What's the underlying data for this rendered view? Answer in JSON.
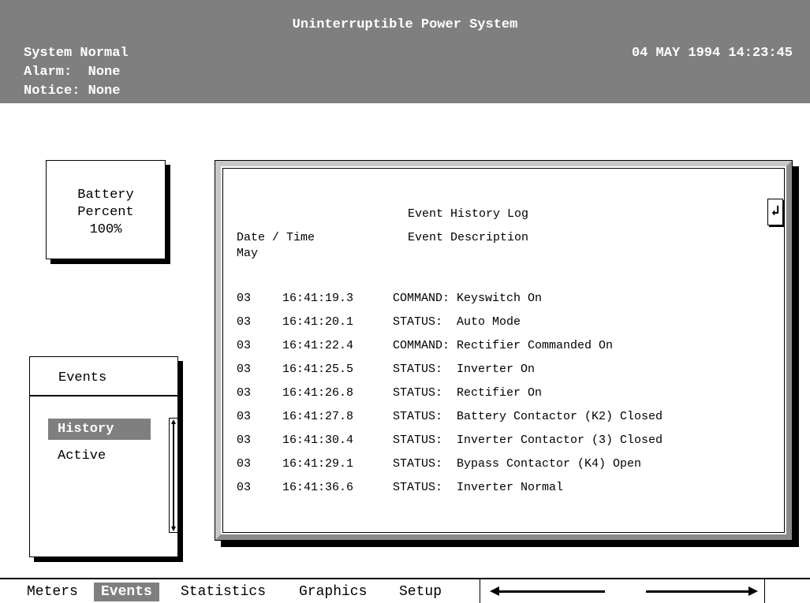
{
  "header": {
    "title": "Uninterruptible Power System",
    "system_status": "System Normal",
    "alarm": "Alarm:  None",
    "notice": "Notice: None",
    "datetime": "04 MAY 1994 14:23:45"
  },
  "battery": {
    "line1": "Battery",
    "line2": "Percent",
    "value": "100%"
  },
  "events_menu": {
    "title": "Events",
    "items": [
      {
        "label": "History",
        "selected": true
      },
      {
        "label": "Active",
        "selected": false
      }
    ]
  },
  "log": {
    "title": "Event History Log",
    "col_datetime": "Date / Time",
    "col_description": "Event Description",
    "month": "May",
    "enter_icon": "enter-arrow-icon",
    "rows": [
      {
        "day": "03",
        "time": "16:41:19.3",
        "desc": "COMMAND: Keyswitch On"
      },
      {
        "day": "03",
        "time": "16:41:20.1",
        "desc": "STATUS:  Auto Mode"
      },
      {
        "day": "03",
        "time": "16:41:22.4",
        "desc": "COMMAND: Rectifier Commanded On"
      },
      {
        "day": "03",
        "time": "16:41:25.5",
        "desc": "STATUS:  Inverter On"
      },
      {
        "day": "03",
        "time": "16:41:26.8",
        "desc": "STATUS:  Rectifier On"
      },
      {
        "day": "03",
        "time": "16:41:27.8",
        "desc": "STATUS:  Battery Contactor (K2) Closed"
      },
      {
        "day": "03",
        "time": "16:41:30.4",
        "desc": "STATUS:  Inverter Contactor (3) Closed"
      },
      {
        "day": "03",
        "time": "16:41:29.1",
        "desc": "STATUS:  Bypass Contactor (K4) Open"
      },
      {
        "day": "03",
        "time": "16:41:36.6",
        "desc": "STATUS:  Inverter Normal"
      }
    ]
  },
  "bottom_tabs": {
    "meters": "Meters",
    "events": "Events",
    "statistics": "Statistics",
    "graphics": "Graphics",
    "setup": "Setup",
    "selected": "Events"
  },
  "colors": {
    "header_bg": "#7f7f7f",
    "selection_bg": "#7f7f7f",
    "text": "#000000",
    "background": "#ffffff"
  }
}
